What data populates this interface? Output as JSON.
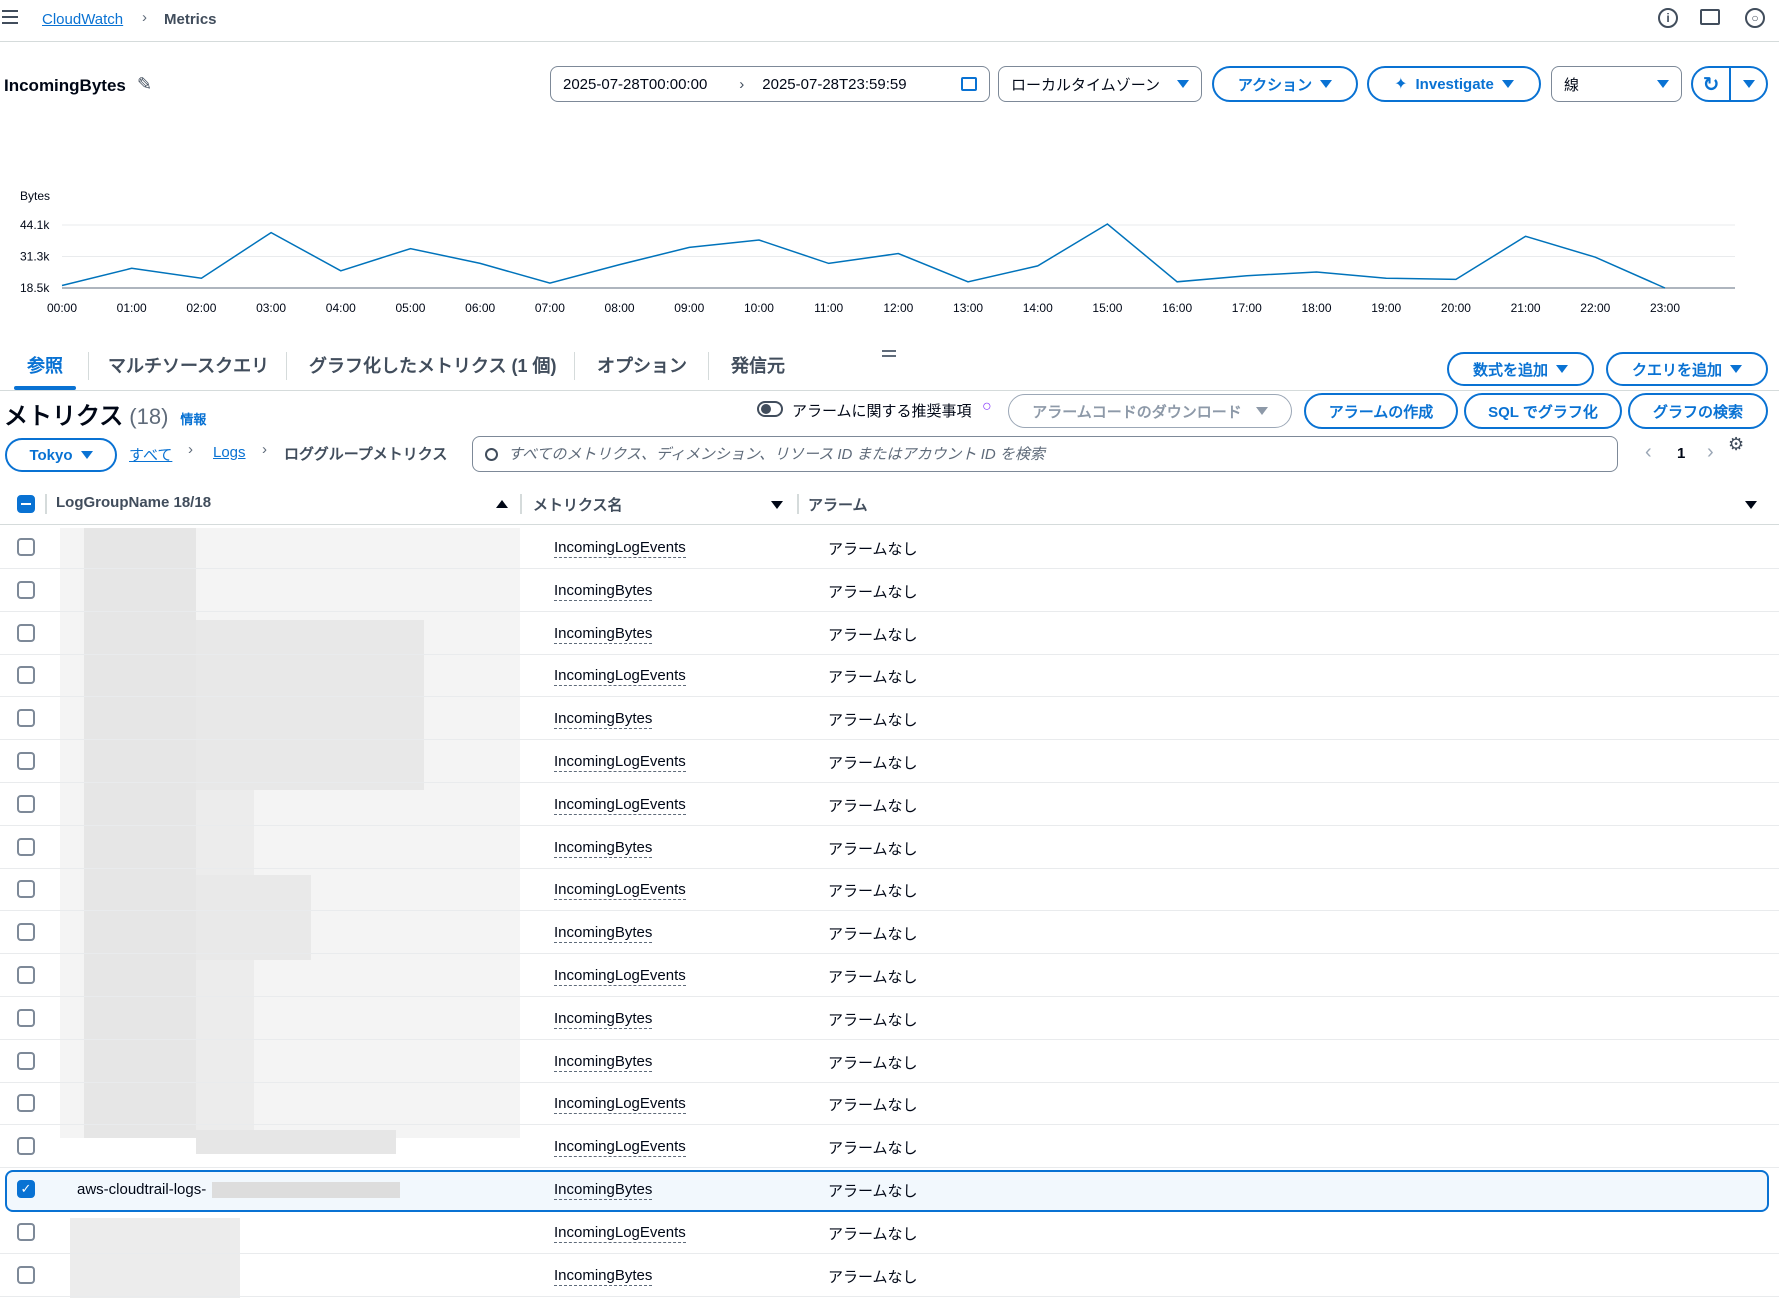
{
  "breadcrumb": {
    "root": "CloudWatch",
    "current": "Metrics"
  },
  "header": {
    "title": "IncomingBytes",
    "date_start": "2025-07-28T00:00:00",
    "date_end": "2025-07-28T23:59:59",
    "timezone": "ローカルタイムゾーン",
    "actions_label": "アクション",
    "investigate_label": "Investigate",
    "graph_type": "線"
  },
  "chart_data": {
    "type": "line",
    "ylabel": "Bytes",
    "y_ticks": [
      "44.1k",
      "31.3k",
      "18.5k"
    ],
    "ylim": [
      18500,
      44100
    ],
    "x": [
      "00:00",
      "01:00",
      "02:00",
      "03:00",
      "04:00",
      "05:00",
      "06:00",
      "07:00",
      "08:00",
      "09:00",
      "10:00",
      "11:00",
      "12:00",
      "13:00",
      "14:00",
      "15:00",
      "16:00",
      "17:00",
      "18:00",
      "19:00",
      "20:00",
      "21:00",
      "22:00",
      "23:00"
    ],
    "series": [
      {
        "values": [
          19500,
          26500,
          22500,
          41000,
          25500,
          34500,
          28500,
          20500,
          28000,
          35000,
          38000,
          28500,
          32500,
          21000,
          27500,
          44500,
          21000,
          23500,
          25000,
          22500,
          22000,
          39500,
          31000,
          18500
        ]
      }
    ],
    "grid": true,
    "color": "#0073bb"
  },
  "tabs": [
    {
      "label": "参照",
      "active": true
    },
    {
      "label": "マルチソースクエリ",
      "active": false
    },
    {
      "label": "グラフ化したメトリクス (1 個)",
      "active": false
    },
    {
      "label": "オプション",
      "active": false
    },
    {
      "label": "発信元",
      "active": false
    }
  ],
  "tab_actions": {
    "add_formula": "数式を追加",
    "add_query": "クエリを追加"
  },
  "metrics": {
    "title": "メトリクス",
    "count": "(18)",
    "info": "情報",
    "alarm_toggle_label": "アラームに関する推奨事項",
    "download_label": "アラームコードのダウンロード",
    "create_alarm": "アラームの作成",
    "sql_graph": "SQL でグラフ化",
    "search_graphs": "グラフの検索",
    "region": "Tokyo",
    "crumbs": [
      "すべて",
      "Logs",
      "ロググループメトリクス"
    ],
    "search_placeholder": "すべてのメトリクス、ディメンション、リソース ID またはアカウント ID を検索",
    "page": "1"
  },
  "table": {
    "col_group": "LogGroupName 18/18",
    "col_metric": "メトリクス名",
    "col_alarm": "アラーム",
    "rows": [
      {
        "metric": "IncomingLogEvents",
        "alarm": "アラームなし"
      },
      {
        "metric": "IncomingBytes",
        "alarm": "アラームなし"
      },
      {
        "metric": "IncomingBytes",
        "alarm": "アラームなし"
      },
      {
        "metric": "IncomingLogEvents",
        "alarm": "アラームなし"
      },
      {
        "metric": "IncomingBytes",
        "alarm": "アラームなし"
      },
      {
        "metric": "IncomingLogEvents",
        "alarm": "アラームなし"
      },
      {
        "metric": "IncomingLogEvents",
        "alarm": "アラームなし"
      },
      {
        "metric": "IncomingBytes",
        "alarm": "アラームなし"
      },
      {
        "metric": "IncomingLogEvents",
        "alarm": "アラームなし"
      },
      {
        "metric": "IncomingBytes",
        "alarm": "アラームなし"
      },
      {
        "metric": "IncomingLogEvents",
        "alarm": "アラームなし"
      },
      {
        "metric": "IncomingBytes",
        "alarm": "アラームなし"
      },
      {
        "metric": "IncomingBytes",
        "alarm": "アラームなし"
      },
      {
        "metric": "IncomingLogEvents",
        "alarm": "アラームなし"
      },
      {
        "metric": "IncomingLogEvents",
        "alarm": "アラームなし"
      },
      {
        "metric": "IncomingBytes",
        "alarm": "アラームなし",
        "group": "aws-cloudtrail-logs-",
        "selected": true
      },
      {
        "metric": "IncomingLogEvents",
        "alarm": "アラームなし"
      },
      {
        "metric": "IncomingBytes",
        "alarm": "アラームなし"
      }
    ]
  }
}
